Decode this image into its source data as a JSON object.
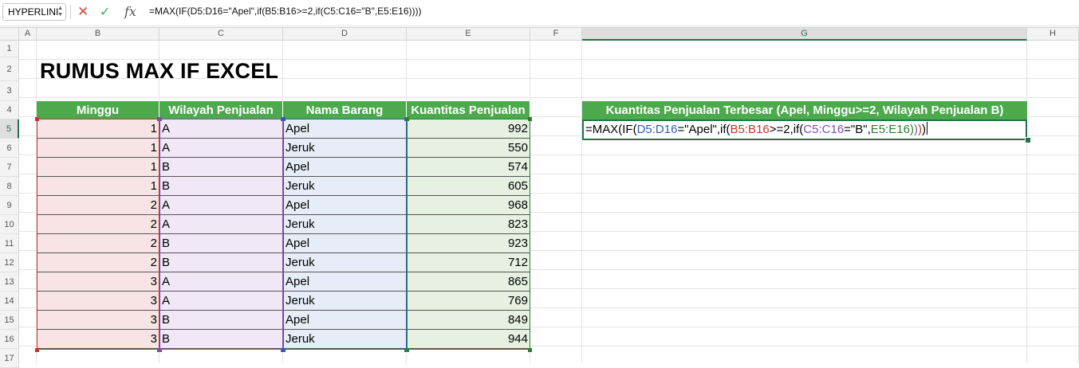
{
  "formula_bar": {
    "name_box": "HYPERLINI",
    "cancel_icon": "✕",
    "enter_icon": "✓",
    "fx_label": "fx",
    "formula": "=MAX(IF(D5:D16=\"Apel\",if(B5:B16>=2,if(C5:C16=\"B\",E5:E16))))"
  },
  "columns": [
    "A",
    "B",
    "C",
    "D",
    "E",
    "F",
    "G",
    "H"
  ],
  "rows": [
    "1",
    "2",
    "3",
    "4",
    "5",
    "6",
    "7",
    "8",
    "9",
    "10",
    "11",
    "12",
    "13",
    "14",
    "15",
    "16",
    "17"
  ],
  "sheet": {
    "title": "RUMUS MAX IF EXCEL",
    "table_headers": [
      "Minggu",
      "Wilayah Penjualan",
      "Nama Barang",
      "Kuantitas Penjualan"
    ],
    "table_rows": [
      [
        "1",
        "A",
        "Apel",
        "992"
      ],
      [
        "1",
        "A",
        "Jeruk",
        "550"
      ],
      [
        "1",
        "B",
        "Apel",
        "574"
      ],
      [
        "1",
        "B",
        "Jeruk",
        "605"
      ],
      [
        "2",
        "A",
        "Apel",
        "968"
      ],
      [
        "2",
        "A",
        "Jeruk",
        "823"
      ],
      [
        "2",
        "B",
        "Apel",
        "923"
      ],
      [
        "2",
        "B",
        "Jeruk",
        "712"
      ],
      [
        "3",
        "A",
        "Apel",
        "865"
      ],
      [
        "3",
        "A",
        "Jeruk",
        "769"
      ],
      [
        "3",
        "B",
        "Apel",
        "849"
      ],
      [
        "3",
        "B",
        "Jeruk",
        "944"
      ]
    ],
    "result_header": "Kuantitas Penjualan Terbesar (Apel, Minggu>=2, Wilayah Penjualan B)",
    "result_formula_parts": [
      {
        "text": "=MAX(IF(",
        "color": "#000000"
      },
      {
        "text": "D5:D16",
        "color": "#2f5fb3"
      },
      {
        "text": "=\"Apel\",if(",
        "color": "#000000"
      },
      {
        "text": "B5:B16",
        "color": "#c0392b"
      },
      {
        "text": ">=2,if(",
        "color": "#000000"
      },
      {
        "text": "C5:C16",
        "color": "#7d4fb3"
      },
      {
        "text": "=\"B\",",
        "color": "#000000"
      },
      {
        "text": "E5:E16",
        "color": "#2e7d32"
      },
      {
        "text": ")",
        "color": "#2e7d32"
      },
      {
        "text": ")",
        "color": "#7d4fb3"
      },
      {
        "text": ")",
        "color": "#c0392b"
      },
      {
        "text": ")",
        "color": "#000000"
      }
    ]
  },
  "colors": {
    "header_green": "#4caa4c",
    "range_b": "#c0392b",
    "range_c": "#7d4fb3",
    "range_d": "#2f5fb3",
    "range_e": "#2e7d32",
    "excel_green": "#217346"
  }
}
